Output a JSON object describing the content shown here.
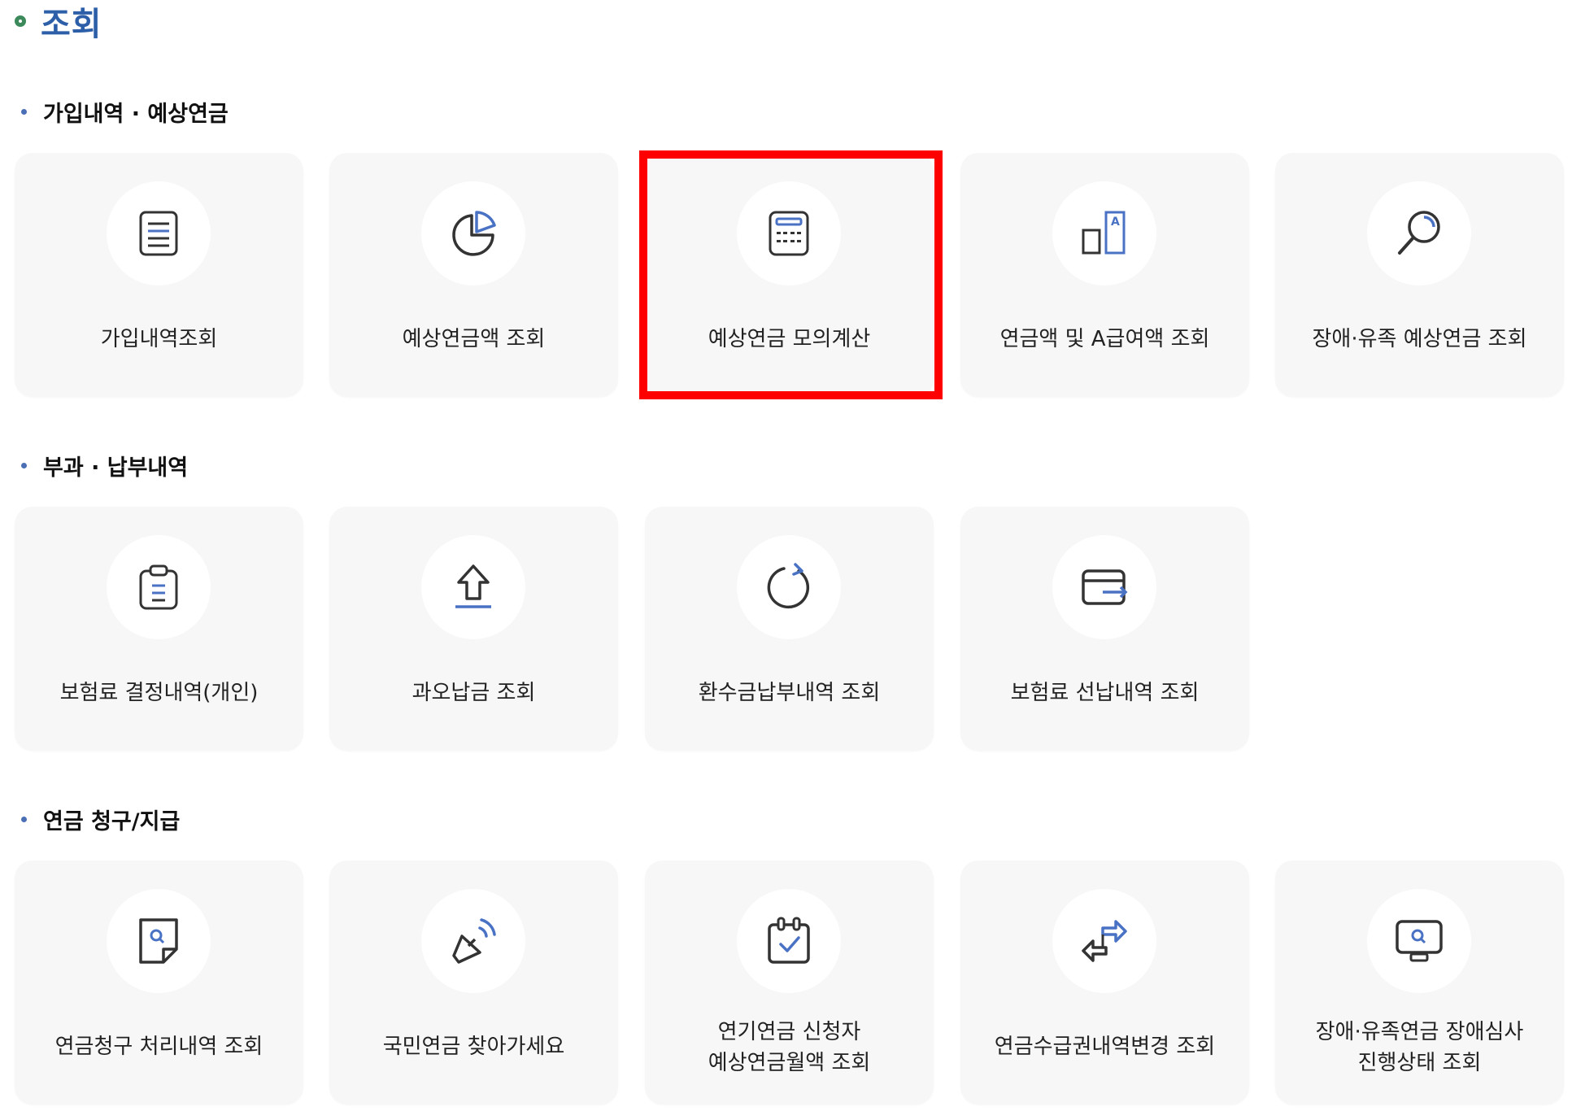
{
  "page": {
    "title": "조회"
  },
  "sections": [
    {
      "title": "가입내역 · 예상연금",
      "tiles": [
        {
          "label": "가입내역조회",
          "icon": "document-lines-icon"
        },
        {
          "label": "예상연금액 조회",
          "icon": "pie-chart-icon"
        },
        {
          "label": "예상연금 모의계산",
          "icon": "calculator-icon",
          "highlighted": true
        },
        {
          "label": "연금액 및 A급여액 조회",
          "icon": "bar-compare-icon"
        },
        {
          "label": "장애·유족 예상연금 조회",
          "icon": "magnifier-icon"
        }
      ]
    },
    {
      "title": "부과 · 납부내역",
      "tiles": [
        {
          "label": "보험료 결정내역(개인)",
          "icon": "clipboard-icon"
        },
        {
          "label": "과오납금 조회",
          "icon": "upload-arrow-icon"
        },
        {
          "label": "환수금납부내역 조회",
          "icon": "refresh-icon"
        },
        {
          "label": "보험료 선납내역 조회",
          "icon": "card-transfer-icon"
        }
      ]
    },
    {
      "title": "연금 청구/지급",
      "tiles": [
        {
          "label": "연금청구 처리내역 조회",
          "icon": "document-search-icon"
        },
        {
          "label": "국민연금 찾아가세요",
          "icon": "megaphone-icon"
        },
        {
          "label_line1": "연기연금 신청자",
          "label_line2": "예상연금월액 조회",
          "icon": "calendar-check-icon"
        },
        {
          "label": "연금수급권내역변경 조회",
          "icon": "exchange-arrows-icon"
        },
        {
          "label_line1": "장애·유족연금 장애심사",
          "label_line2": "진행상태 조회",
          "icon": "monitor-search-icon"
        }
      ]
    }
  ],
  "colors": {
    "icon_stroke": "#333333",
    "icon_accent": "#4a72c4",
    "title": "#2d5fa8",
    "highlight": "#ff0000",
    "tile_bg": "#f7f7f8"
  }
}
